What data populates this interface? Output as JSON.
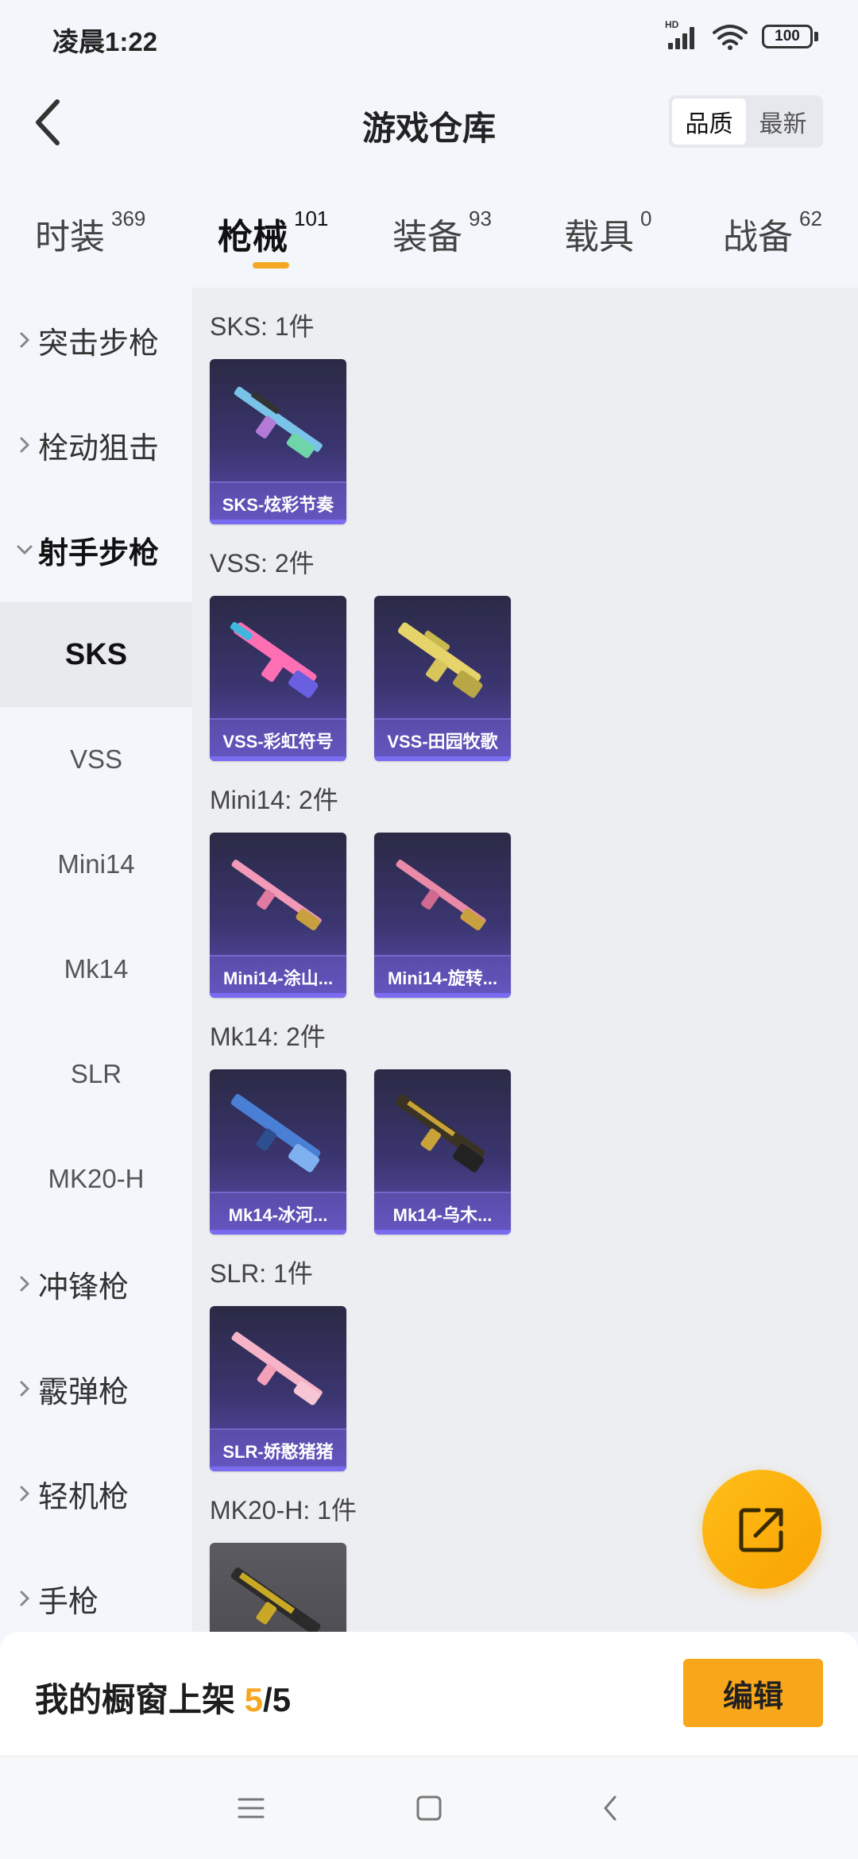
{
  "status_bar": {
    "time": "凌晨1:22",
    "hd": "HD",
    "battery": "100"
  },
  "header": {
    "title": "游戏仓库",
    "sort_options": [
      "品质",
      "最新"
    ],
    "active_sort": "品质"
  },
  "tabs": [
    {
      "label": "时装",
      "count": "369"
    },
    {
      "label": "枪械",
      "count": "101",
      "active": true
    },
    {
      "label": "装备",
      "count": "93"
    },
    {
      "label": "载具",
      "count": "0"
    },
    {
      "label": "战备",
      "count": "62"
    }
  ],
  "sidebar": {
    "categories": [
      {
        "label": "突击步枪",
        "expanded": false
      },
      {
        "label": "栓动狙击",
        "expanded": false
      },
      {
        "label": "射手步枪",
        "expanded": true
      },
      {
        "label": "冲锋枪",
        "expanded": false
      },
      {
        "label": "霰弹枪",
        "expanded": false
      },
      {
        "label": "轻机枪",
        "expanded": false
      },
      {
        "label": "手枪",
        "expanded": false
      }
    ],
    "subitems": [
      {
        "label": "SKS",
        "active": true
      },
      {
        "label": "VSS"
      },
      {
        "label": "Mini14"
      },
      {
        "label": "Mk14"
      },
      {
        "label": "SLR"
      },
      {
        "label": "MK20-H"
      }
    ]
  },
  "groups": [
    {
      "title": "SKS: 1件",
      "items": [
        {
          "name": "SKS-炫彩节奏",
          "icon": "rifle-rainbow-icon",
          "color": "#7ac3e8"
        }
      ]
    },
    {
      "title": "VSS: 2件",
      "items": [
        {
          "name": "VSS-彩虹符号",
          "icon": "rifle-pink-icon",
          "color": "#ff6fb4"
        },
        {
          "name": "VSS-田园牧歌",
          "icon": "rifle-gold-icon",
          "color": "#e6d36a"
        }
      ]
    },
    {
      "title": "Mini14: 2件",
      "items": [
        {
          "name": "Mini14-涂山...",
          "icon": "rifle-pink-icon",
          "color": "#f29ab8"
        },
        {
          "name": "Mini14-旋转...",
          "icon": "rifle-pink-icon",
          "color": "#e88aa8"
        }
      ]
    },
    {
      "title": "Mk14: 2件",
      "items": [
        {
          "name": "Mk14-冰河...",
          "icon": "rifle-blue-icon",
          "color": "#4a7fd6"
        },
        {
          "name": "Mk14-乌木...",
          "icon": "rifle-gold-icon",
          "color": "#c9a23a"
        }
      ]
    },
    {
      "title": "SLR: 1件",
      "items": [
        {
          "name": "SLR-娇憨猪猪",
          "icon": "rifle-pink-icon",
          "color": "#f7b4c8"
        }
      ]
    },
    {
      "title": "MK20-H: 1件",
      "items": [
        {
          "name": "",
          "icon": "rifle-gold-icon",
          "color": "#c9a826"
        }
      ]
    }
  ],
  "showcase": {
    "label": "我的橱窗上架 ",
    "current": "5",
    "separator": "/",
    "total": "5",
    "edit_label": "编辑"
  },
  "colors": {
    "accent": "#f5a623",
    "card_purple": "#5a4fb3"
  }
}
